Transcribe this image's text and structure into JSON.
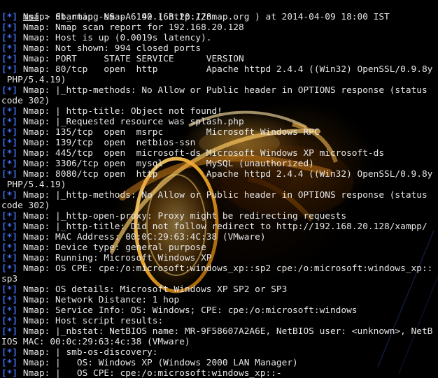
{
  "terminal": {
    "prompt": {
      "msf": "msf",
      "sep": " > ",
      "command": "db_nmap -sS -A 192.168.20.128"
    },
    "lines": [
      {
        "prefix": "[*]",
        "text": " Nmap: Starting Nmap 6.40 ( http://nmap.org ) at 2014-04-09 18:00 IST"
      },
      {
        "prefix": "[*]",
        "text": " Nmap: Nmap scan report for 192.168.20.128"
      },
      {
        "prefix": "[*]",
        "text": " Nmap: Host is up (0.0019s latency)."
      },
      {
        "prefix": "[*]",
        "text": " Nmap: Not shown: 994 closed ports"
      },
      {
        "prefix": "[*]",
        "text": " Nmap: PORT     STATE SERVICE      VERSION"
      },
      {
        "prefix": "[*]",
        "text": " Nmap: 80/tcp   open  http         Apache httpd 2.4.4 ((Win32) OpenSSL/0.9.8y"
      },
      {
        "prefix": "",
        "text": " PHP/5.4.19)"
      },
      {
        "prefix": "[*]",
        "text": " Nmap: |_http-methods: No Allow or Public header in OPTIONS response (status"
      },
      {
        "prefix": "",
        "text": "code 302)"
      },
      {
        "prefix": "[*]",
        "text": " Nmap: | http-title: Object not found!"
      },
      {
        "prefix": "[*]",
        "text": " Nmap: |_Requested resource was splash.php"
      },
      {
        "prefix": "[*]",
        "text": " Nmap: 135/tcp  open  msrpc        Microsoft Windows RPC"
      },
      {
        "prefix": "[*]",
        "text": " Nmap: 139/tcp  open  netbios-ssn"
      },
      {
        "prefix": "[*]",
        "text": " Nmap: 445/tcp  open  microsoft-ds Microsoft Windows XP microsoft-ds"
      },
      {
        "prefix": "[*]",
        "text": " Nmap: 3306/tcp open  mysql        MySQL (unauthorized)"
      },
      {
        "prefix": "[*]",
        "text": " Nmap: 8080/tcp open  http         Apache httpd 2.4.4 ((Win32) OpenSSL/0.9.8y"
      },
      {
        "prefix": "",
        "text": " PHP/5.4.19)"
      },
      {
        "prefix": "[*]",
        "text": " Nmap: |_http-methods: No Allow or Public header in OPTIONS response (status"
      },
      {
        "prefix": "",
        "text": "code 302)"
      },
      {
        "prefix": "[*]",
        "text": " Nmap: |_http-open-proxy: Proxy might be redirecting requests"
      },
      {
        "prefix": "[*]",
        "text": " Nmap: |_http-title: Did not follow redirect to http://192.168.20.128/xampp/"
      },
      {
        "prefix": "[*]",
        "text": " Nmap: MAC Address: 00:0C:29:63:4C:38 (VMware)"
      },
      {
        "prefix": "[*]",
        "text": " Nmap: Device type: general purpose"
      },
      {
        "prefix": "[*]",
        "text": " Nmap: Running: Microsoft Windows XP"
      },
      {
        "prefix": "[*]",
        "text": " Nmap: OS CPE: cpe:/o:microsoft:windows_xp::sp2 cpe:/o:microsoft:windows_xp::"
      },
      {
        "prefix": "",
        "text": "sp3"
      },
      {
        "prefix": "[*]",
        "text": " Nmap: OS details: Microsoft Windows XP SP2 or SP3"
      },
      {
        "prefix": "[*]",
        "text": " Nmap: Network Distance: 1 hop"
      },
      {
        "prefix": "[*]",
        "text": " Nmap: Service Info: OS: Windows; CPE: cpe:/o:microsoft:windows"
      },
      {
        "prefix": "[*]",
        "text": " Nmap: Host script results:"
      },
      {
        "prefix": "[*]",
        "text": " Nmap: |_nbstat: NetBIOS name: MR-9F58607A2A6E, NetBIOS user: <unknown>, NetB"
      },
      {
        "prefix": "",
        "text": "IOS MAC: 00:0c:29:63:4c:38 (VMware)"
      },
      {
        "prefix": "[*]",
        "text": " Nmap: | smb-os-discovery:"
      },
      {
        "prefix": "[*]",
        "text": " Nmap: |   OS: Windows XP (Windows 2000 LAN Manager)"
      },
      {
        "prefix": "[*]",
        "text": " Nmap: |   OS CPE: cpe:/o:microsoft:windows_xp::-"
      }
    ]
  },
  "colors": {
    "background": "#000000",
    "text": "#e6e6e6",
    "bracket": "#3f6de8",
    "glow": "#ffb347"
  }
}
